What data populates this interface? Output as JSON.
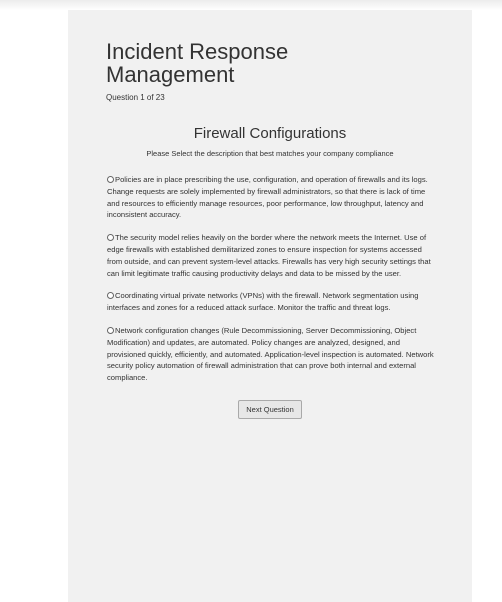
{
  "header": {
    "title": "Incident Response Management",
    "question_count": "Question 1 of 23"
  },
  "question": {
    "title": "Firewall Configurations",
    "instruction": "Please Select the description that best matches your company compliance",
    "options": [
      {
        "label": "Policies are in place prescribing the use, configuration, and operation of firewalls and its logs. Change requests are solely implemented by firewall administrators, so that there is lack of time and resources to efficiently manage resources, poor performance, low throughput, latency and inconsistent accuracy."
      },
      {
        "label": "The security model relies heavily on the border where the network meets the Internet. Use of edge firewalls with established demilitarized zones to ensure inspection for systems accessed from outside, and can prevent system-level attacks. Firewalls has very high security settings that can limit legitimate traffic causing productivity delays and data to be missed by the user."
      },
      {
        "label": "Coordinating virtual private networks (VPNs) with the firewall. Network segmentation using interfaces and zones for a reduced attack surface. Monitor the traffic and threat logs."
      },
      {
        "label": "Network configuration changes (Rule Decommissioning, Server Decommissioning, Object Modification) and updates, are automated. Policy changes are analyzed, designed, and provisioned quickly, efficiently, and automated. Application-level inspection is automated. Network security policy automation of firewall administration that can prove both internal and external compliance."
      }
    ]
  },
  "buttons": {
    "next_label": "Next Question"
  }
}
